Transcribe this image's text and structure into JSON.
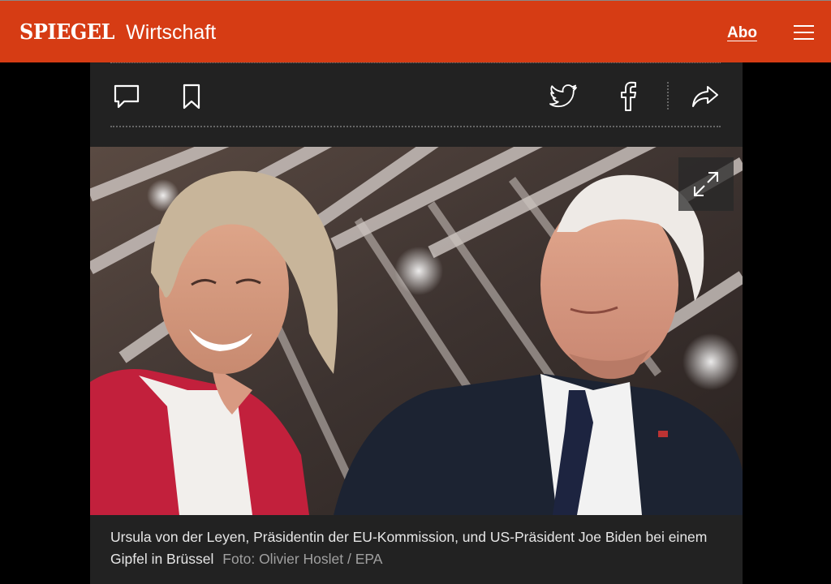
{
  "header": {
    "logo": "SPIEGEL",
    "section": "Wirtschaft",
    "abo_label": "Abo",
    "menu_icon": "hamburger-menu-icon",
    "background_color": "#d63c14"
  },
  "toolbar": {
    "comment_icon": "comment-icon",
    "bookmark_icon": "bookmark-icon",
    "twitter_icon": "twitter-icon",
    "facebook_icon": "facebook-icon",
    "share_icon": "share-arrow-icon"
  },
  "photo": {
    "expand_icon": "expand-icon",
    "caption": "Ursula von der Leyen, Präsidentin der EU-Kommission, und US-Präsident Joe Biden bei einem Gipfel in Brüssel",
    "credit_prefix": "Foto:",
    "credit": "Olivier Hoslet / EPA"
  }
}
